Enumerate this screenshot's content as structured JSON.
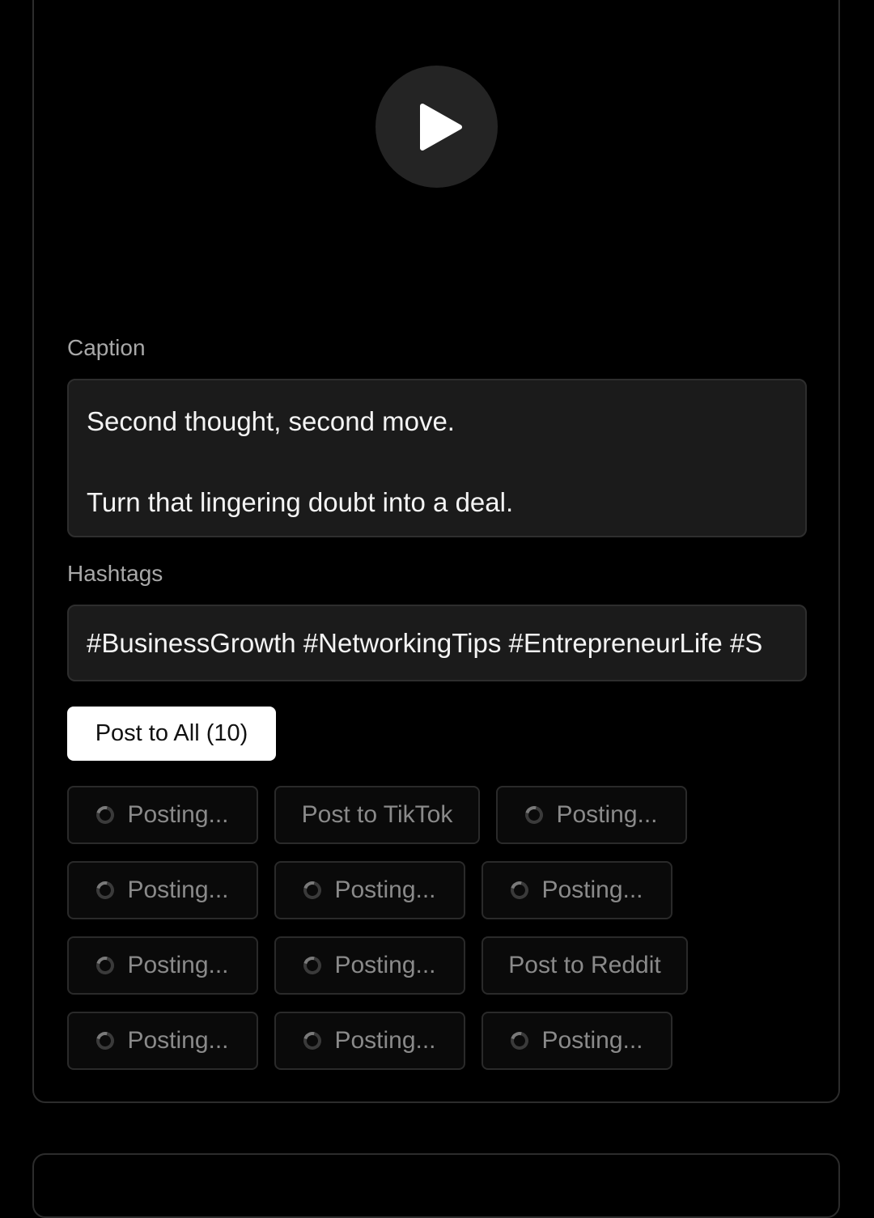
{
  "video": {
    "play_icon": "play-icon"
  },
  "caption": {
    "label": "Caption",
    "value": "Second thought, second move.\n\nTurn that lingering doubt into a deal."
  },
  "hashtags": {
    "label": "Hashtags",
    "value": "#BusinessGrowth #NetworkingTips #EntrepreneurLife #S"
  },
  "post_all": {
    "label": "Post to All (10)"
  },
  "platform_buttons": [
    {
      "label": "Posting...",
      "loading": true
    },
    {
      "label": "Post to TikTok",
      "loading": false
    },
    {
      "label": "Posting...",
      "loading": true
    },
    {
      "label": "Posting...",
      "loading": true
    },
    {
      "label": "Posting...",
      "loading": true
    },
    {
      "label": "Posting...",
      "loading": true
    },
    {
      "label": "Posting...",
      "loading": true
    },
    {
      "label": "Posting...",
      "loading": true
    },
    {
      "label": "Post to Reddit",
      "loading": false
    },
    {
      "label": "Posting...",
      "loading": true
    },
    {
      "label": "Posting...",
      "loading": true
    },
    {
      "label": "Posting...",
      "loading": true
    }
  ]
}
